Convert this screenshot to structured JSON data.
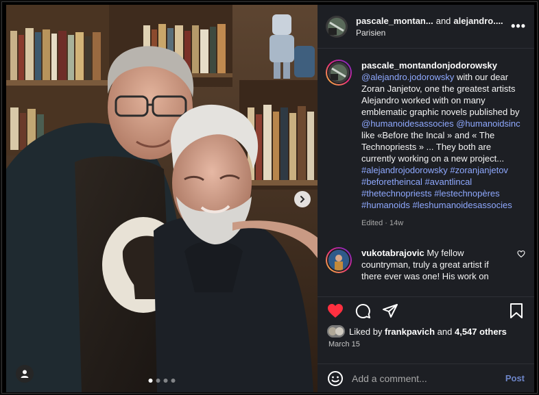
{
  "header": {
    "username_primary": "pascale_montan...",
    "and_text": "and",
    "username_secondary": "alejandro....",
    "location": "Parisien",
    "more_label": "•••"
  },
  "caption": {
    "username": "pascale_montandonjodorowsky",
    "parts": [
      {
        "type": "link",
        "text": "@alejandro.jodorowsky"
      },
      {
        "type": "text",
        "text": " with our dear Zoran Janjetov, one the greatest artists Alejandro worked with on many emblematic graphic novels published by "
      },
      {
        "type": "link",
        "text": "@humanoidesassocies"
      },
      {
        "type": "text",
        "text": " "
      },
      {
        "type": "link",
        "text": "@humanoidsinc"
      },
      {
        "type": "text",
        "text": " like «Before the Incal » and « The Technopriests » ... They both are currently working on a new project..."
      }
    ],
    "hashtags": [
      "#alejandrojodorowsky",
      "#zoranjanjetov",
      "#beforetheincal",
      "#avantlincal",
      "#thetechnopriests",
      "#lestechnopères",
      "#humanoids",
      "#leshumanoidesassocies"
    ],
    "meta": "Edited · 14w"
  },
  "comment": {
    "username": "vukotabrajovic",
    "text": "My fellow countryman, truly a great artist if there ever was one! His work on"
  },
  "likes": {
    "prefix": "Liked by",
    "user": "frankpavich",
    "middle": "and",
    "count": "4,547 others"
  },
  "date": "March 15",
  "add_comment": {
    "placeholder": "Add a comment...",
    "post_label": "Post"
  },
  "carousel": {
    "dot_count": 4,
    "active_index": 0
  },
  "colors": {
    "like_red": "#ff3040",
    "link_blue": "#8fa9ff",
    "panel_bg": "#1d1f24"
  }
}
